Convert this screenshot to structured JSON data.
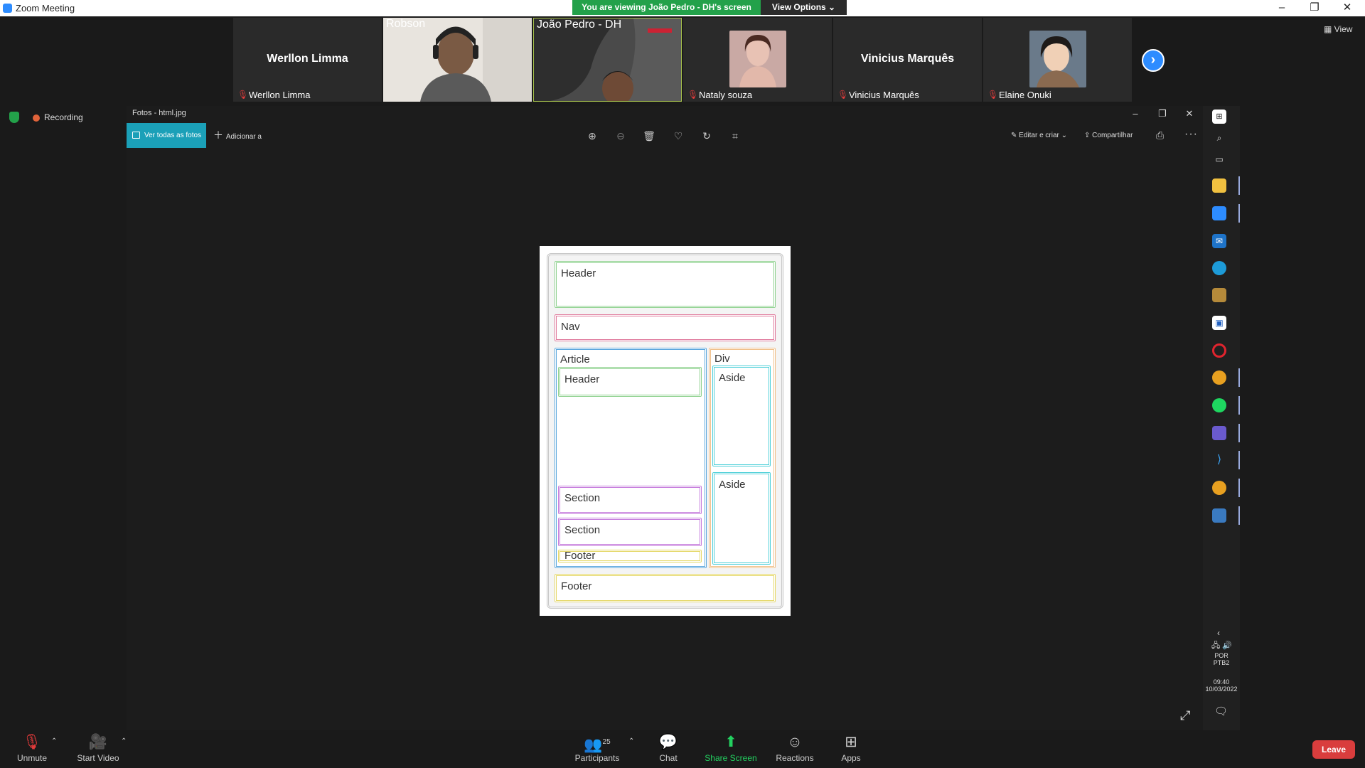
{
  "window": {
    "title": "Zoom Meeting",
    "viewing_banner": "You are viewing João Pedro - DH's screen",
    "view_options": "View Options ⌄",
    "controls": [
      "–",
      "❐",
      "✕"
    ]
  },
  "participants": {
    "tiles": [
      {
        "type": "name",
        "display_name": "Werllon Limma",
        "label": "Werllon Limma",
        "muted": true
      },
      {
        "type": "video",
        "label": "Robson",
        "muted": false
      },
      {
        "type": "video",
        "label": "João Pedro - DH",
        "muted": false
      },
      {
        "type": "photo",
        "label": "Nataly souza",
        "muted": true
      },
      {
        "type": "name",
        "display_name": "Vinicius Marquês",
        "label": "Vinicius Marquês",
        "muted": true
      },
      {
        "type": "photo",
        "label": "Elaine Onuki",
        "muted": true
      }
    ],
    "next_icon": "›",
    "view_label": "View"
  },
  "recording": {
    "label": "Recording"
  },
  "photos": {
    "title": "Fotos - html.jpg",
    "ver_todas": "Ver todas as fotos",
    "adicionar": "Adicionar a",
    "toolbar_icons": [
      "zoom-in-icon",
      "zoom-out-icon",
      "delete-icon",
      "favorite-icon",
      "rotate-icon",
      "crop-icon"
    ],
    "editar": "Editar e criar",
    "compartilhar": "Compartilhar",
    "diagram": {
      "header": "Header",
      "nav": "Nav",
      "article": "Article",
      "article_header": "Header",
      "section1": "Section",
      "section2": "Section",
      "article_footer": "Footer",
      "div": "Div",
      "aside1": "Aside",
      "aside2": "Aside",
      "footer": "Footer"
    }
  },
  "taskbar": {
    "lang1": "POR",
    "lang2": "PTB2",
    "time": "09:40",
    "date": "10/03/2022"
  },
  "toolbar": {
    "unmute": "Unmute",
    "start_video": "Start Video",
    "participants": "Participants",
    "participant_count": "25",
    "chat": "Chat",
    "share": "Share Screen",
    "reactions": "Reactions",
    "apps": "Apps",
    "leave": "Leave"
  },
  "colors": {
    "accent": "#2d8cff",
    "banner_green": "#23a14a",
    "leave_red": "#d93d3d",
    "photos_teal": "#1ba0b8",
    "header_green": "#8fd18f",
    "nav_pink": "#e07a9c",
    "article_blue": "#5ba7dd",
    "div_orange": "#f0c08a",
    "aside_cyan": "#4fd0d8",
    "section_purple": "#c57bdc",
    "footer_yellow": "#e5d86a"
  }
}
